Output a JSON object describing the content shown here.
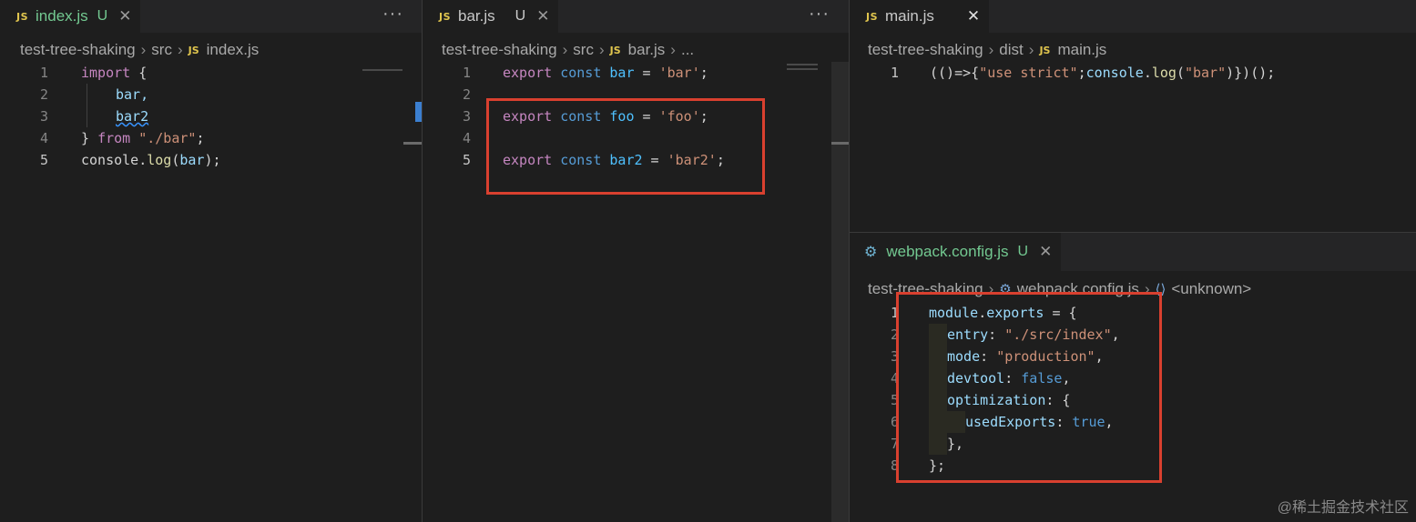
{
  "panes": {
    "left": {
      "tab": {
        "icon": "JS",
        "name": "index.js",
        "status": "U",
        "close": "✕"
      },
      "more": "···",
      "breadcrumb": [
        "test-tree-shaking",
        "src",
        "index.js"
      ],
      "lines": [
        "1",
        "2",
        "3",
        "4",
        "5"
      ]
    },
    "middle": {
      "tab": {
        "icon": "JS",
        "name": "bar.js",
        "status": "U",
        "close": "✕"
      },
      "more": "···",
      "breadcrumb": [
        "test-tree-shaking",
        "src",
        "bar.js",
        "..."
      ],
      "lines": [
        "1",
        "2",
        "3",
        "4",
        "5"
      ]
    },
    "right_top": {
      "tab": {
        "icon": "JS",
        "name": "main.js",
        "close": "✕"
      },
      "breadcrumb": [
        "test-tree-shaking",
        "dist",
        "main.js"
      ],
      "lines": [
        "1"
      ]
    },
    "right_bottom": {
      "tab": {
        "name": "webpack.config.js",
        "status": "U",
        "close": "✕"
      },
      "breadcrumb": [
        "test-tree-shaking",
        "webpack.config.js",
        "<unknown>"
      ],
      "lines": [
        "1",
        "2",
        "3",
        "4",
        "5",
        "6",
        "7",
        "8"
      ]
    }
  },
  "code": {
    "left": {
      "l1": [
        "import",
        " {"
      ],
      "l2": "bar,",
      "l3": "bar2",
      "l4": [
        "} ",
        "from",
        " ",
        "\"./bar\"",
        ";"
      ],
      "l5": [
        "console",
        ".",
        "log",
        "(",
        "bar",
        ");"
      ]
    },
    "middle": {
      "l1": [
        "export",
        " ",
        "const",
        " ",
        "bar",
        " = ",
        "'bar'",
        ";"
      ],
      "l3": [
        "export",
        " ",
        "const",
        " ",
        "foo",
        " = ",
        "'foo'",
        ";"
      ],
      "l5": [
        "export",
        " ",
        "const",
        " ",
        "bar2",
        " = ",
        "'bar2'",
        ";"
      ]
    },
    "right_top": {
      "l1": [
        "(()=>{",
        "\"use strict\"",
        ";",
        "console",
        ".",
        "log",
        "(",
        "\"bar\"",
        ")})();"
      ]
    },
    "right_bottom": {
      "l1": [
        "module",
        ".",
        "exports",
        " = {"
      ],
      "l2": [
        "entry",
        ": ",
        "\"./src/index\"",
        ","
      ],
      "l3": [
        "mode",
        ": ",
        "\"production\"",
        ","
      ],
      "l4": [
        "devtool",
        ": ",
        "false",
        ","
      ],
      "l5": [
        "optimization",
        ": {"
      ],
      "l6": [
        "usedExports",
        ": ",
        "true",
        ","
      ],
      "l7": "},",
      "l8": "};"
    }
  },
  "watermark": "@稀土掘金技术社区",
  "colors": {
    "highlight": "#d9402f",
    "keyword": "#c586c0",
    "string": "#ce9178",
    "variable": "#9cdcfe"
  }
}
